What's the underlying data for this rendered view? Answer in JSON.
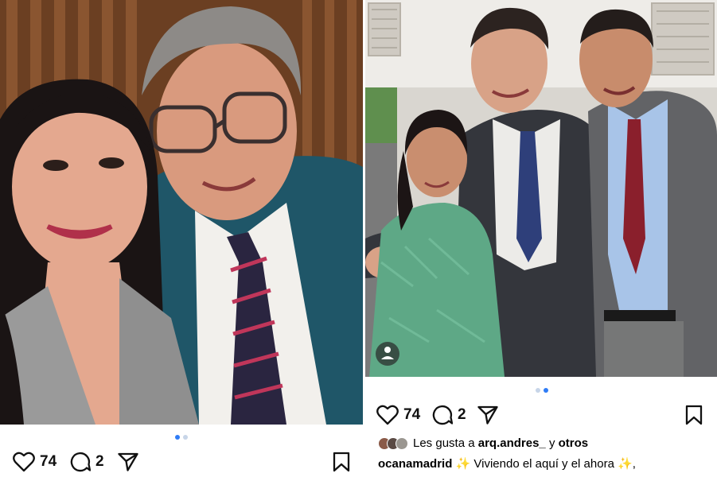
{
  "posts": [
    {
      "id": "left",
      "likes": "74",
      "comments": "2",
      "carousel": {
        "total": 2,
        "active": 1
      },
      "photo_desc_icons": {
        "like": "heart-icon",
        "comment": "comment-bubble-icon",
        "share": "paper-plane-icon",
        "save": "bookmark-icon"
      }
    },
    {
      "id": "right",
      "likes": "74",
      "comments": "2",
      "carousel": {
        "total": 2,
        "active": 2
      },
      "liked_by": {
        "prefix": "Les gusta a",
        "user": "arq.andres_",
        "connector": "y",
        "others": "otros"
      },
      "caption": {
        "username": "ocanamadrid",
        "text": "Viviendo el aquí y el ahora",
        "sparkle": "✨",
        "trailing": ","
      }
    }
  ],
  "colors": {
    "accent_blue": "#2f7cf6",
    "sparkle": "#e6b800"
  }
}
